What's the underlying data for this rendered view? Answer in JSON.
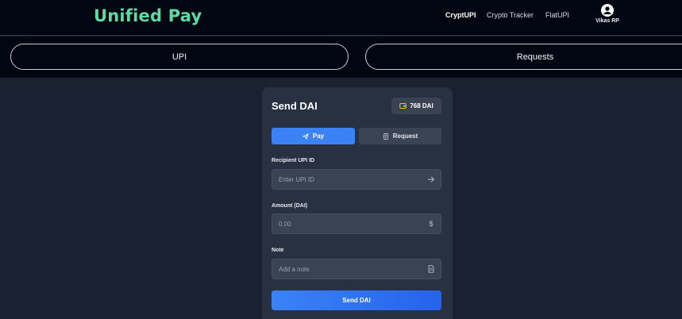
{
  "header": {
    "brand": "Unified Pay",
    "nav": [
      {
        "label": "CryptUPI",
        "active": true
      },
      {
        "label": "Crypto Tracker",
        "active": false
      },
      {
        "label": "FlatUPI",
        "active": false
      }
    ],
    "user": {
      "name": "Vikas RP",
      "icon": "user-circle-icon"
    }
  },
  "tabs": {
    "upi": "UPI",
    "requests": "Requests"
  },
  "card": {
    "title": "Send DAI",
    "balance": {
      "text": "768 DAI",
      "icon": "wallet-icon",
      "icon_color": "#f5c518"
    },
    "toggle": {
      "pay": {
        "label": "Pay",
        "icon": "send-icon",
        "active": true
      },
      "request": {
        "label": "Request",
        "icon": "receipt-icon",
        "active": false
      }
    },
    "fields": {
      "recipient": {
        "label": "Recipient UPI ID",
        "placeholder": "Enter UPI ID",
        "value": "",
        "icon": "arrow-right-icon"
      },
      "amount": {
        "label": "Amount (DAI)",
        "placeholder": "0.00",
        "value": "",
        "icon": "dollar-icon",
        "icon_glyph": "$"
      },
      "note": {
        "label": "Note",
        "placeholder": "Add a note",
        "value": "",
        "icon": "document-icon"
      }
    },
    "submit_label": "Send DAI"
  },
  "colors": {
    "brand": "#5fd9a6",
    "accent": "#3b82f6",
    "background": "#1a2231",
    "card": "#283142",
    "topbar": "#020611"
  }
}
